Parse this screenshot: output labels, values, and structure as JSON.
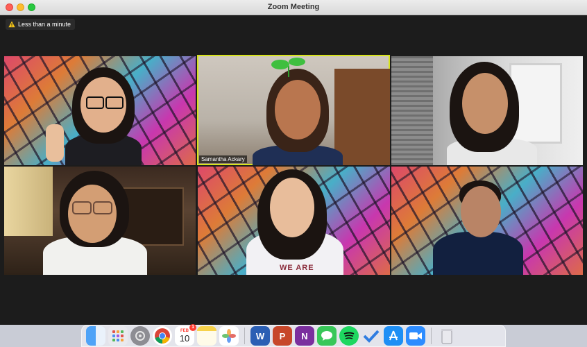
{
  "window": {
    "title": "Zoom Meeting"
  },
  "meeting": {
    "time_badge": "Less than a minute"
  },
  "participants": [
    {
      "name": ""
    },
    {
      "name": "Samantha Ackary",
      "active_speaker": true
    },
    {
      "name": ""
    },
    {
      "name": ""
    },
    {
      "name": "",
      "shirt_text": "WE ARE"
    },
    {
      "name": ""
    }
  ],
  "dock": {
    "calendar": {
      "month": "FEB",
      "day": "10",
      "badge": "1"
    },
    "apps": [
      "Finder",
      "Launchpad",
      "System Preferences",
      "Chrome",
      "Calendar",
      "Notes",
      "Photos",
      "Word",
      "PowerPoint",
      "OneNote",
      "Messages",
      "Spotify",
      "Tasks",
      "App Store",
      "Zoom",
      "Trash"
    ]
  }
}
